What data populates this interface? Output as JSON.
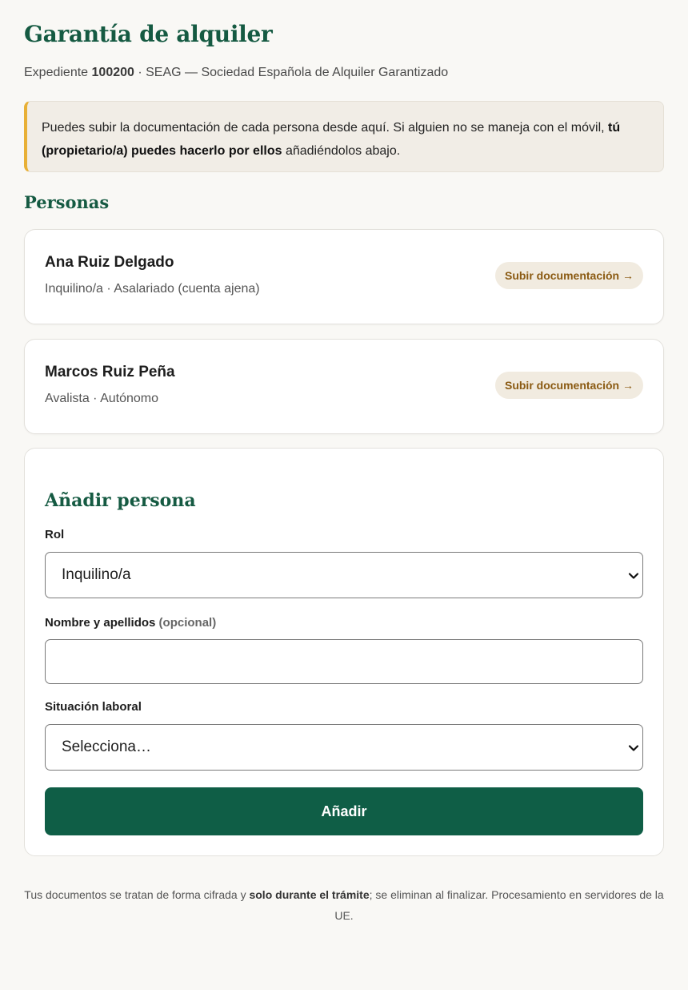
{
  "header": {
    "title": "Garantía de alquiler",
    "expediente_label": "Expediente",
    "expediente_number": "100200",
    "expediente_rest": " · SEAG — Sociedad Española de Alquiler Garantizado"
  },
  "notice": {
    "part1": "Puedes subir la documentación de cada persona desde aquí. Si alguien no se maneja con el móvil, ",
    "bold": "tú (propietario/a) puedes hacerlo por ellos",
    "part2": " añadiéndolos abajo."
  },
  "persons_section": {
    "title": "Personas",
    "upload_label": "Subir documentación →",
    "items": [
      {
        "name": "Ana Ruiz Delgado",
        "meta": "Inquilino/a · Asalariado (cuenta ajena)"
      },
      {
        "name": "Marcos Ruiz Peña",
        "meta": "Avalista · Autónomo"
      }
    ]
  },
  "add_form": {
    "title": "Añadir persona",
    "role_label": "Rol",
    "role_value": "Inquilino/a",
    "name_label": "Nombre y apellidos",
    "name_optional": "(opcional)",
    "name_value": "",
    "work_label": "Situación laboral",
    "work_value": "Selecciona…",
    "submit_label": "Añadir"
  },
  "footer": {
    "part1": "Tus documentos se tratan de forma cifrada y ",
    "bold": "solo durante el trámite",
    "part2": "; se eliminan al finalizar. Procesamiento en servidores de la UE."
  },
  "colors": {
    "accent": "#155a42",
    "button": "#0f5e46",
    "notice_border": "#e8b036",
    "upload_text": "#8a5a12"
  }
}
